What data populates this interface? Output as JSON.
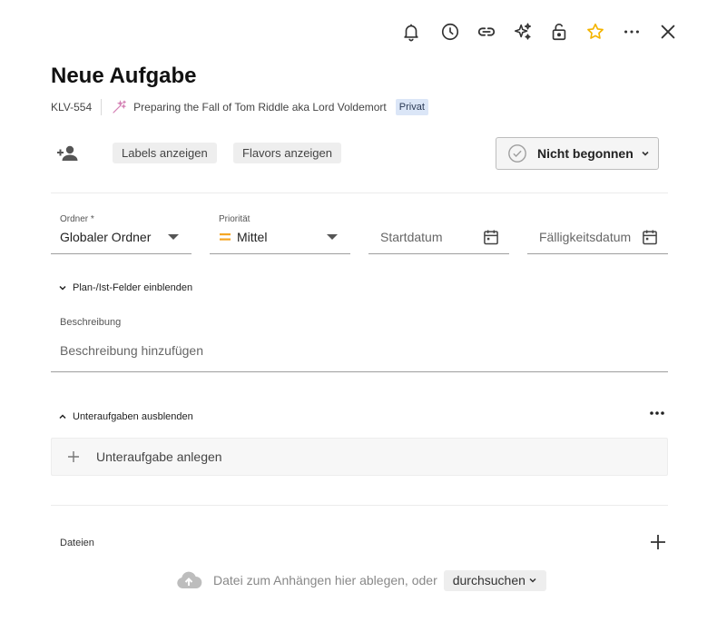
{
  "toolbar": {
    "icons": [
      "bell-icon",
      "clock-icon",
      "link-icon",
      "sparkles-icon",
      "unlock-icon",
      "star-icon",
      "more-horizontal-icon",
      "close-icon"
    ],
    "star_color": "#f4b400"
  },
  "task": {
    "title": "Neue Aufgabe",
    "id": "KLV-554",
    "project": "Preparing the Fall of Tom Riddle aka Lord Voldemort",
    "visibility_badge": "Privat",
    "project_icon": "magic-wand-icon",
    "project_icon_color": "#d480b4"
  },
  "actions": {
    "assign_icon": "add-person-icon",
    "labels_label": "Labels anzeigen",
    "flavors_label": "Flavors anzeigen",
    "status_label": "Nicht begonnen"
  },
  "fields": {
    "folder": {
      "label": "Ordner *",
      "value": "Globaler Ordner"
    },
    "priority": {
      "label": "Priorität",
      "value": "Mittel",
      "color": "#f5a623"
    },
    "start_date": {
      "placeholder": "Startdatum"
    },
    "due_date": {
      "placeholder": "Fälligkeitsdatum"
    }
  },
  "plan_toggle": "Plan-/Ist-Felder einblenden",
  "description": {
    "label": "Beschreibung",
    "placeholder": "Beschreibung hinzufügen"
  },
  "subtasks": {
    "toggle": "Unteraufgaben ausblenden",
    "add_label": "Unteraufgabe anlegen"
  },
  "files": {
    "label": "Dateien",
    "drop_text": "Datei zum Anhängen hier ablegen, oder",
    "browse_label": "durchsuchen"
  }
}
